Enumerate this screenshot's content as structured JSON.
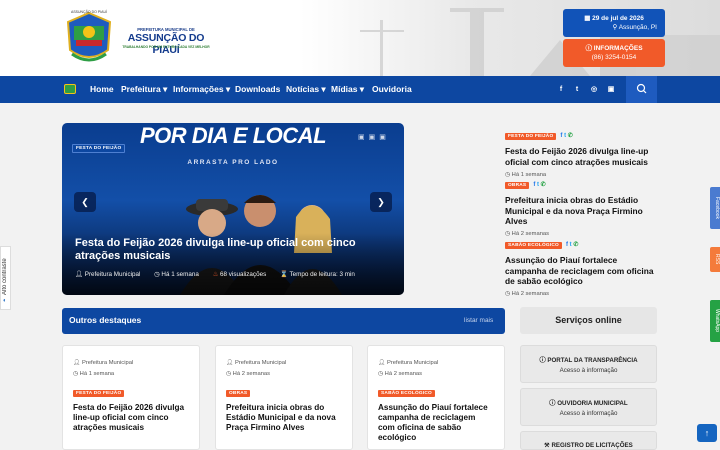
{
  "header": {
    "logo_top": "ASSUNÇÃO DO PIAUÍ",
    "logo_prefix": "PREFEITURA MUNICIPAL DE",
    "logo_name": "ASSUNÇÃO DO PIAUÍ",
    "logo_slogan": "TRABALHANDO POR UM FUTURO CADA VEZ MELHOR",
    "date": "29 de jul de 2026",
    "location": "Assunção, PI",
    "info_label": "INFORMAÇÕES",
    "phone": "(86) 3254-0154"
  },
  "nav": {
    "items": [
      {
        "label": "Home"
      },
      {
        "label": "Prefeitura ▾"
      },
      {
        "label": "Informações ▾"
      },
      {
        "label": "Downloads"
      },
      {
        "label": "Notícias ▾"
      },
      {
        "label": "Mídias ▾"
      },
      {
        "label": "Ouvidoria"
      }
    ],
    "social": [
      "f",
      "t",
      "◎",
      "▣"
    ]
  },
  "slide": {
    "banner": "POR DIA E LOCAL",
    "banner_sub": "ARRASTA PRO LADO",
    "tag": "FESTA DO FEIJÃO",
    "title": "Festa do Feijão 2026 divulga line-up oficial com cinco atrações musicais",
    "author": "Prefeitura Municipal",
    "time": "Há 1 semana",
    "views": "68 visualizações",
    "read_time": "Tempo de leitura: 3 min"
  },
  "side_news": [
    {
      "tag": "FESTA DO FEIJÃO",
      "title": "Festa do Feijão 2026 divulga line-up oficial com cinco atrações musicais",
      "time": "Há 1 semana"
    },
    {
      "tag": "OBRAS",
      "title": "Prefeitura inicia obras do Estádio Municipal e da nova Praça Firmino Alves",
      "time": "Há 2 semanas"
    },
    {
      "tag": "SABÃO ECOLÓGICO",
      "title": "Assunção do Piauí fortalece campanha de reciclagem com oficina de sabão ecológico",
      "time": "Há 2 semanas"
    }
  ],
  "destaques": {
    "title": "Outros destaques",
    "link": "listar mais",
    "cards": [
      {
        "author": "Prefeitura Municipal",
        "time": "Há 1 semana",
        "tag": "FESTA DO FEIJÃO",
        "title": "Festa do Feijão 2026 divulga line-up oficial com cinco atrações musicais"
      },
      {
        "author": "Prefeitura Municipal",
        "time": "Há 2 semanas",
        "tag": "OBRAS",
        "title": "Prefeitura inicia obras do Estádio Municipal e da nova Praça Firmino Alves"
      },
      {
        "author": "Prefeitura Municipal",
        "time": "Há 2 semanas",
        "tag": "SABÃO ECOLÓGICO",
        "title": "Assunção do Piauí fortalece campanha de reciclagem com oficina de sabão ecológico"
      }
    ]
  },
  "servicos": {
    "title": "Serviços online",
    "items": [
      {
        "title": "PORTAL DA TRANSPARÊNCIA",
        "sub": "Acesso à informação"
      },
      {
        "title": "OUVIDORIA MUNICIPAL",
        "sub": "Acesso à informação"
      },
      {
        "title": "REGISTRO DE LICITAÇÕES",
        "sub": ""
      }
    ]
  },
  "side_tabs": {
    "contrast": "Alto contraste",
    "facebook": "Facebook",
    "rss": "RSS",
    "whatsapp": "WhatsApp"
  },
  "colors": {
    "primary": "#0d47a1",
    "accent": "#f15a29",
    "whatsapp": "#25a244"
  }
}
